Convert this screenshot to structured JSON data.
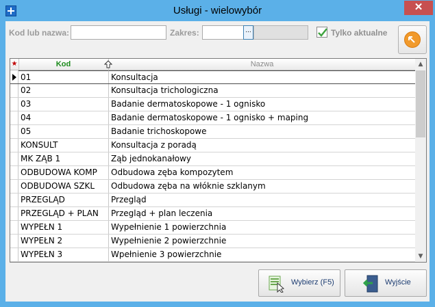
{
  "window": {
    "title": "Usługi - wielowybór",
    "app_icon": "plus-icon",
    "close_label": "✕"
  },
  "filters": {
    "kod_label": "Kod lub nazwa:",
    "kod_value": "",
    "zakres_label": "Zakres:",
    "zakres_value": "",
    "zakres_button": "...",
    "tylko_label": "Tylko aktualne",
    "tylko_checked": true
  },
  "grid": {
    "columns": {
      "marker": "★",
      "kod": "Kod",
      "nazwa": "Nazwa"
    },
    "rows": [
      {
        "kod": "01",
        "nazwa": "Konsultacja"
      },
      {
        "kod": "02",
        "nazwa": "Konsultacja trichologiczna"
      },
      {
        "kod": "03",
        "nazwa": "Badanie dermatoskopowe - 1 ognisko"
      },
      {
        "kod": "04",
        "nazwa": "Badanie dermatoskopowe - 1 ognisko + maping"
      },
      {
        "kod": "05",
        "nazwa": "Badanie trichoskopowe"
      },
      {
        "kod": "KONSULT",
        "nazwa": "Konsultacja z poradą"
      },
      {
        "kod": "MK ZĄB 1",
        "nazwa": "Ząb jednokanałowy"
      },
      {
        "kod": "ODBUDOWA KOMP",
        "nazwa": "Odbudowa zęba kompozytem"
      },
      {
        "kod": "ODBUDOWA SZKL",
        "nazwa": "Odbudowa zęba na włóknie szklanym"
      },
      {
        "kod": "PRZEGLĄD",
        "nazwa": "Przegląd"
      },
      {
        "kod": "PRZEGLĄD + PLAN",
        "nazwa": "Przegląd + plan leczenia"
      },
      {
        "kod": "WYPEŁN 1",
        "nazwa": "Wypełnienie 1 powierzchnia"
      },
      {
        "kod": "WYPEŁN 2",
        "nazwa": "Wypełnienie 2 powierzchnie"
      },
      {
        "kod": "WYPEŁN 3",
        "nazwa": "Wpełnienie 3 powierzchnie"
      }
    ]
  },
  "buttons": {
    "wybierz": "Wybierz (F5)",
    "wyjscie": "Wyjście"
  },
  "colors": {
    "accent_frame": "#5bb0e8",
    "close_button": "#c75050",
    "kod_header": "#1a8a1a"
  }
}
